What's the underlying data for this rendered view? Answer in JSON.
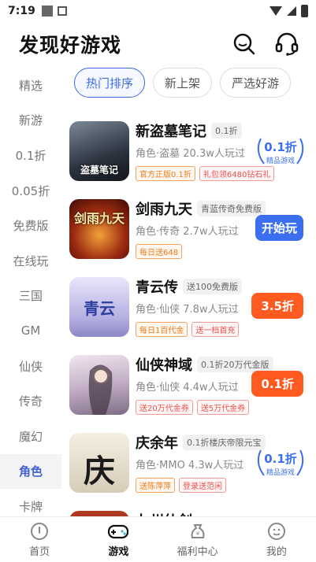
{
  "status": {
    "time": "7:19"
  },
  "header": {
    "title": "发现好游戏",
    "search_icon": "search-icon",
    "service_icon": "headset-icon"
  },
  "sidebar": [
    {
      "label": "精选"
    },
    {
      "label": "新游"
    },
    {
      "label": "0.1折"
    },
    {
      "label": "0.05折"
    },
    {
      "label": "免费版"
    },
    {
      "label": "在线玩"
    },
    {
      "label": "三国"
    },
    {
      "label": "GM"
    },
    {
      "label": "仙侠"
    },
    {
      "label": "传奇"
    },
    {
      "label": "魔幻"
    },
    {
      "label": "角色",
      "active": true
    },
    {
      "label": "卡牌"
    }
  ],
  "tabs": [
    {
      "label": "热门排序",
      "active": true
    },
    {
      "label": "新上架"
    },
    {
      "label": "严选好游"
    }
  ],
  "games": [
    {
      "name": "新盗墓笔记",
      "tag": "0.1折",
      "meta": "角色·盗墓 20.3w人玩过",
      "chips": [
        "官方正版0.1折",
        "礼包领6480钻石礼"
      ],
      "action_type": "seal",
      "seal_big": "0.1折",
      "seal_small": "精品游戏",
      "cover_text": "盗墓笔记",
      "cover_color": "#3a4654"
    },
    {
      "name": "剑雨九天",
      "tag": "青蓝传奇免费版",
      "meta": "角色·传奇 2.7w人玩过",
      "chips": [
        "每日送648"
      ],
      "action_type": "play",
      "action_label": "开始玩",
      "cover_text": "剑雨九天",
      "cover_color": "#7a1f12"
    },
    {
      "name": "青云传",
      "tag": "送100免费版",
      "meta": "角色·仙侠 7.8w人玩过",
      "chips": [
        "每日1百代金",
        "送一档首充"
      ],
      "action_type": "discount",
      "action_label": "3.5折",
      "cover_text": "青云",
      "cover_color": "#a9a6d8"
    },
    {
      "name": "仙侠神域",
      "tag": "0.1折20万代金版",
      "meta": "角色·仙侠 4.4w人玩过",
      "chips": [
        "送20万代金券",
        "送5万代金券"
      ],
      "action_type": "discount",
      "action_label": "0.1折",
      "cover_text": "",
      "cover_color": "#c7b6c8"
    },
    {
      "name": "庆余年",
      "tag": "0.1折楼庆帝限元宝",
      "meta": "角色·MMO 4.3w人玩过",
      "chips": [
        "送陈萍萍",
        "登录送范闲"
      ],
      "action_type": "seal",
      "seal_big": "0.1折",
      "seal_small": "精品游戏",
      "cover_text": "庆",
      "cover_color": "#d9d3c5"
    },
    {
      "name": "九州仙剑",
      "tag": "",
      "meta": "",
      "chips": [],
      "action_type": "none",
      "cover_text": "",
      "cover_color": "#8a2a1e"
    }
  ],
  "bottom_nav": [
    {
      "label": "首页",
      "icon": "home-icon"
    },
    {
      "label": "游戏",
      "icon": "gamepad-icon",
      "active": true
    },
    {
      "label": "福利中心",
      "icon": "gift-bag-icon"
    },
    {
      "label": "我的",
      "icon": "profile-icon"
    }
  ]
}
